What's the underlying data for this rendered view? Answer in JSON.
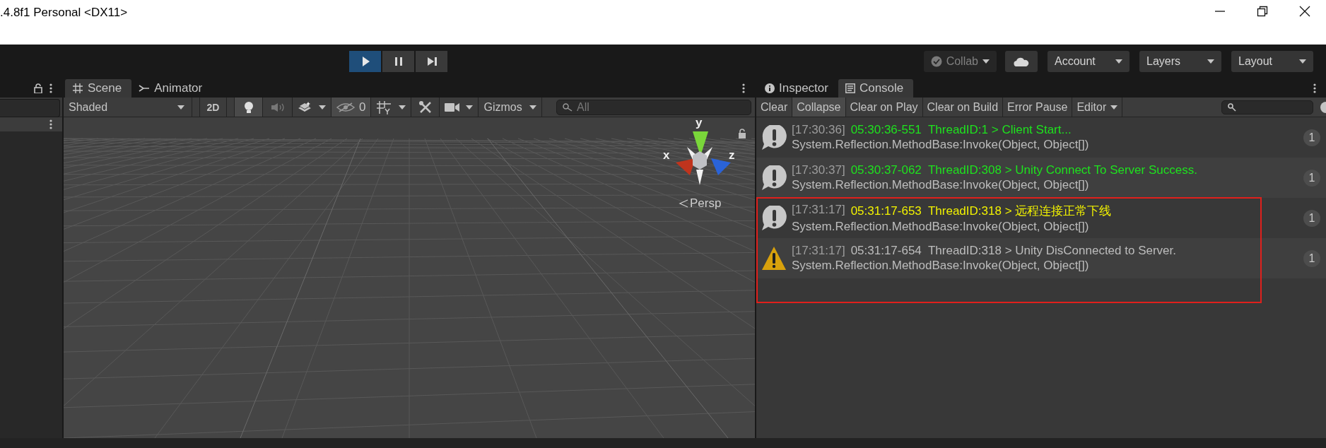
{
  "window": {
    "title": ".4.8f1 Personal <DX11>"
  },
  "toolbar": {
    "play_buttons": [
      {
        "kind": "play",
        "selected": true
      },
      {
        "kind": "pause",
        "selected": false
      },
      {
        "kind": "step",
        "selected": false
      }
    ],
    "collab": {
      "label": "Collab",
      "disabled": true
    },
    "menus": [
      "Account",
      "Layers",
      "Layout"
    ]
  },
  "scene_panel": {
    "tabs": [
      {
        "kind": "scene",
        "label": "Scene",
        "selected": true
      },
      {
        "kind": "animator",
        "label": "Animator",
        "selected": false
      }
    ],
    "shading": "Shaded",
    "mode_2d": {
      "label": "2D",
      "on": false
    },
    "lighting_on": true,
    "audio_on": false,
    "hidden_count": "0",
    "gizmos": "Gizmos",
    "search": {
      "placeholder": "All"
    },
    "gizmo": {
      "axes": [
        {
          "kind": "y",
          "label": "y"
        },
        {
          "kind": "x",
          "label": "x"
        },
        {
          "kind": "z",
          "label": "z"
        }
      ],
      "projection": "Persp"
    }
  },
  "console_panel": {
    "tabs": [
      {
        "kind": "info",
        "label": "Inspector",
        "selected": false
      },
      {
        "kind": "console",
        "label": "Console",
        "selected": true
      }
    ],
    "buttons": [
      {
        "label": "Clear",
        "on": false,
        "dropdown": false
      },
      {
        "label": "Collapse",
        "on": true,
        "dropdown": false
      },
      {
        "label": "Clear on Play",
        "on": false,
        "dropdown": false
      },
      {
        "label": "Clear on Build",
        "on": false,
        "dropdown": false
      },
      {
        "label": "Error Pause",
        "on": false,
        "dropdown": false
      },
      {
        "label": "Editor",
        "on": false,
        "dropdown": true
      }
    ],
    "messages": [
      {
        "kind": "log",
        "time": "[17:30:36]",
        "text": "05:30:36-551  ThreadID:1 > Client Start...",
        "trace": "System.Reflection.MethodBase:Invoke(Object, Object[])",
        "color": "#1ee21e",
        "count": "1",
        "highlighted": false
      },
      {
        "kind": "log",
        "time": "[17:30:37]",
        "text": "05:30:37-062  ThreadID:308 > Unity Connect To Server Success.",
        "trace": "System.Reflection.MethodBase:Invoke(Object, Object[])",
        "color": "#1ee21e",
        "count": "1",
        "highlighted": false
      },
      {
        "kind": "log",
        "time": "[17:31:17]",
        "text": "05:31:17-653  ThreadID:318 > 远程连接正常下线",
        "trace": "System.Reflection.MethodBase:Invoke(Object, Object[])",
        "color": "#f2f200",
        "count": "1",
        "highlighted": true
      },
      {
        "kind": "warning",
        "time": "[17:31:17]",
        "text": "05:31:17-654  ThreadID:318 > Unity DisConnected to Server.",
        "trace": "System.Reflection.MethodBase:Invoke(Object, Object[])",
        "color": "#bdbdbd",
        "count": "1",
        "highlighted": true
      }
    ]
  }
}
